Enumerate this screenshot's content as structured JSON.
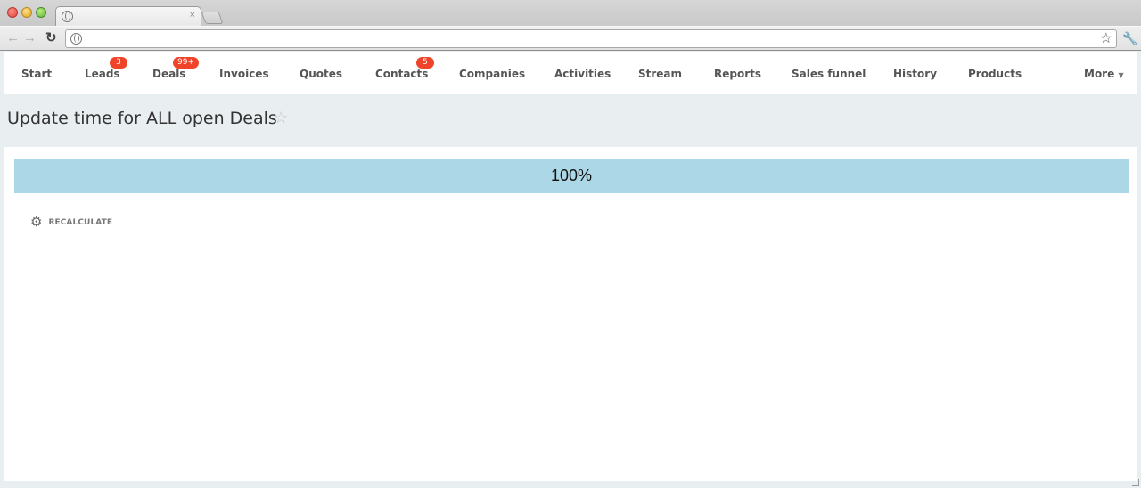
{
  "browser": {
    "tab_close": "×",
    "icons": {
      "back": "arrow-left-icon",
      "forward": "arrow-right-icon",
      "reload": "reload-icon",
      "bookmark": "star-icon",
      "settings": "wrench-icon"
    }
  },
  "nav": {
    "items": [
      {
        "label": "Start",
        "badge": ""
      },
      {
        "label": "Leads",
        "badge": "3"
      },
      {
        "label": "Deals",
        "badge": "99+"
      },
      {
        "label": "Invoices",
        "badge": ""
      },
      {
        "label": "Quotes",
        "badge": ""
      },
      {
        "label": "Contacts",
        "badge": "5"
      },
      {
        "label": "Companies",
        "badge": ""
      },
      {
        "label": "Activities",
        "badge": ""
      },
      {
        "label": "Stream",
        "badge": ""
      },
      {
        "label": "Reports",
        "badge": ""
      },
      {
        "label": "Sales funnel",
        "badge": ""
      },
      {
        "label": "History",
        "badge": ""
      },
      {
        "label": "Products",
        "badge": ""
      }
    ],
    "more_label": "More",
    "badge_color": "#f0442a"
  },
  "page": {
    "title": "Update time for ALL open Deals"
  },
  "progress": {
    "value_percent": 100,
    "label": "100%",
    "color": "#acd7e6"
  },
  "actions": {
    "recalculate_label": "RECALCULATE"
  }
}
